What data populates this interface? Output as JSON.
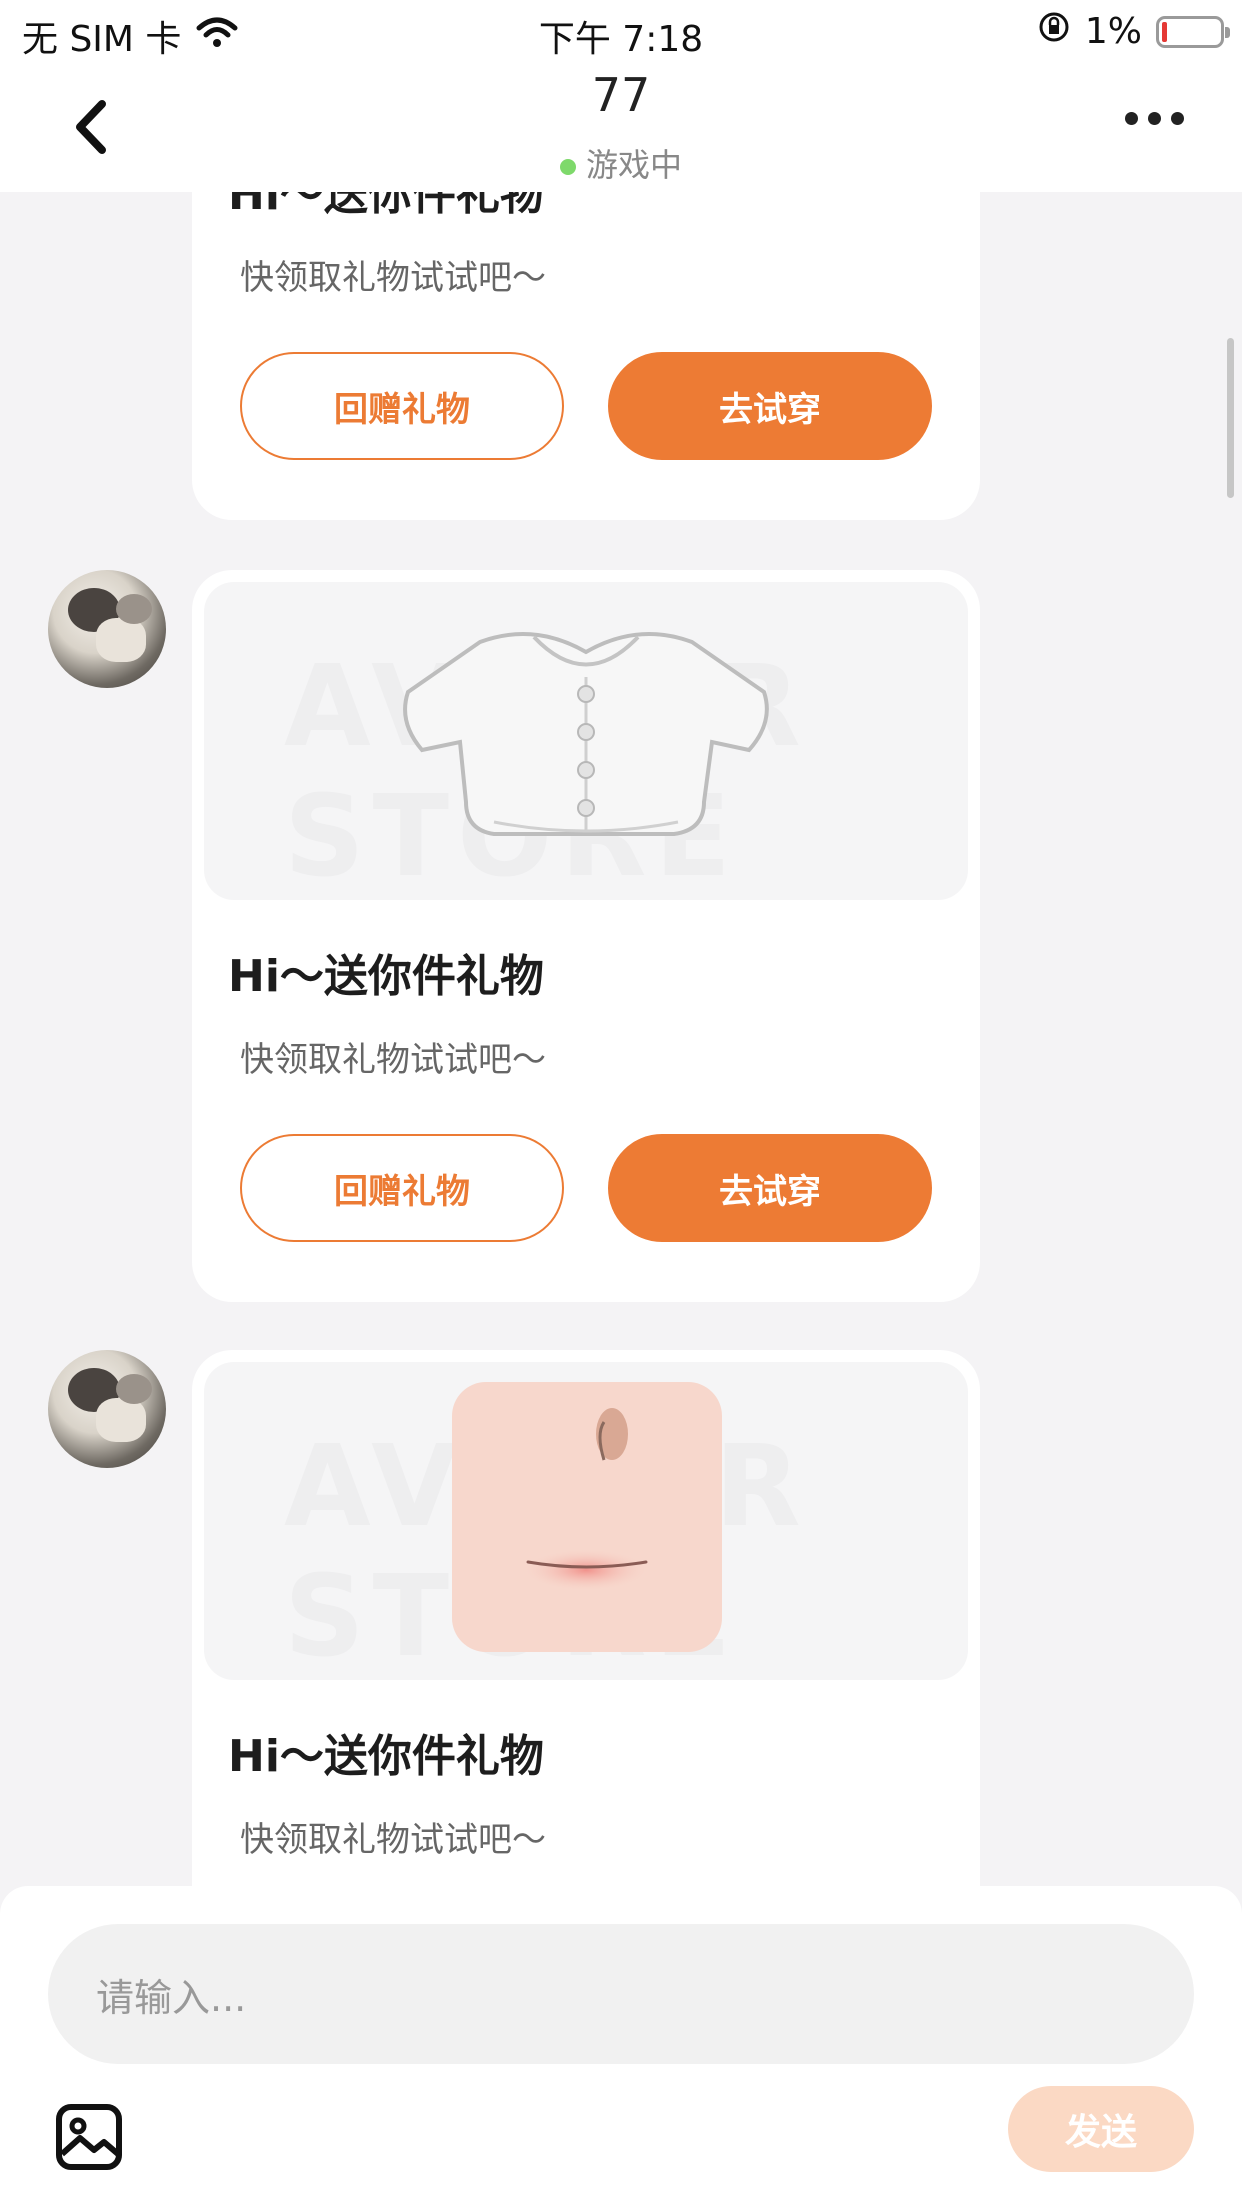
{
  "status_bar": {
    "carrier": "无 SIM 卡",
    "time": "下午 7:18",
    "battery_percent": "1%"
  },
  "nav": {
    "title": "77",
    "status": "游戏中"
  },
  "messages": [
    {
      "title": "Hi～送你件礼物",
      "subtitle": "快领取礼物试试吧～",
      "return_gift_label": "回赠礼物",
      "try_on_label": "去试穿"
    },
    {
      "watermark": "AVATAR STORE",
      "item_icon": "white-blouse-icon",
      "title": "Hi～送你件礼物",
      "subtitle": "快领取礼物试试吧～",
      "return_gift_label": "回赠礼物",
      "try_on_label": "去试穿"
    },
    {
      "watermark": "AVATAR STORE",
      "item_icon": "face-makeup-icon",
      "title": "Hi～送你件礼物",
      "subtitle": "快领取礼物试试吧～"
    }
  ],
  "composer": {
    "placeholder": "请输入...",
    "send_label": "发送"
  },
  "colors": {
    "accent": "#ed7b34",
    "send_disabled": "#fbd9c4",
    "online": "#7ed96b"
  }
}
